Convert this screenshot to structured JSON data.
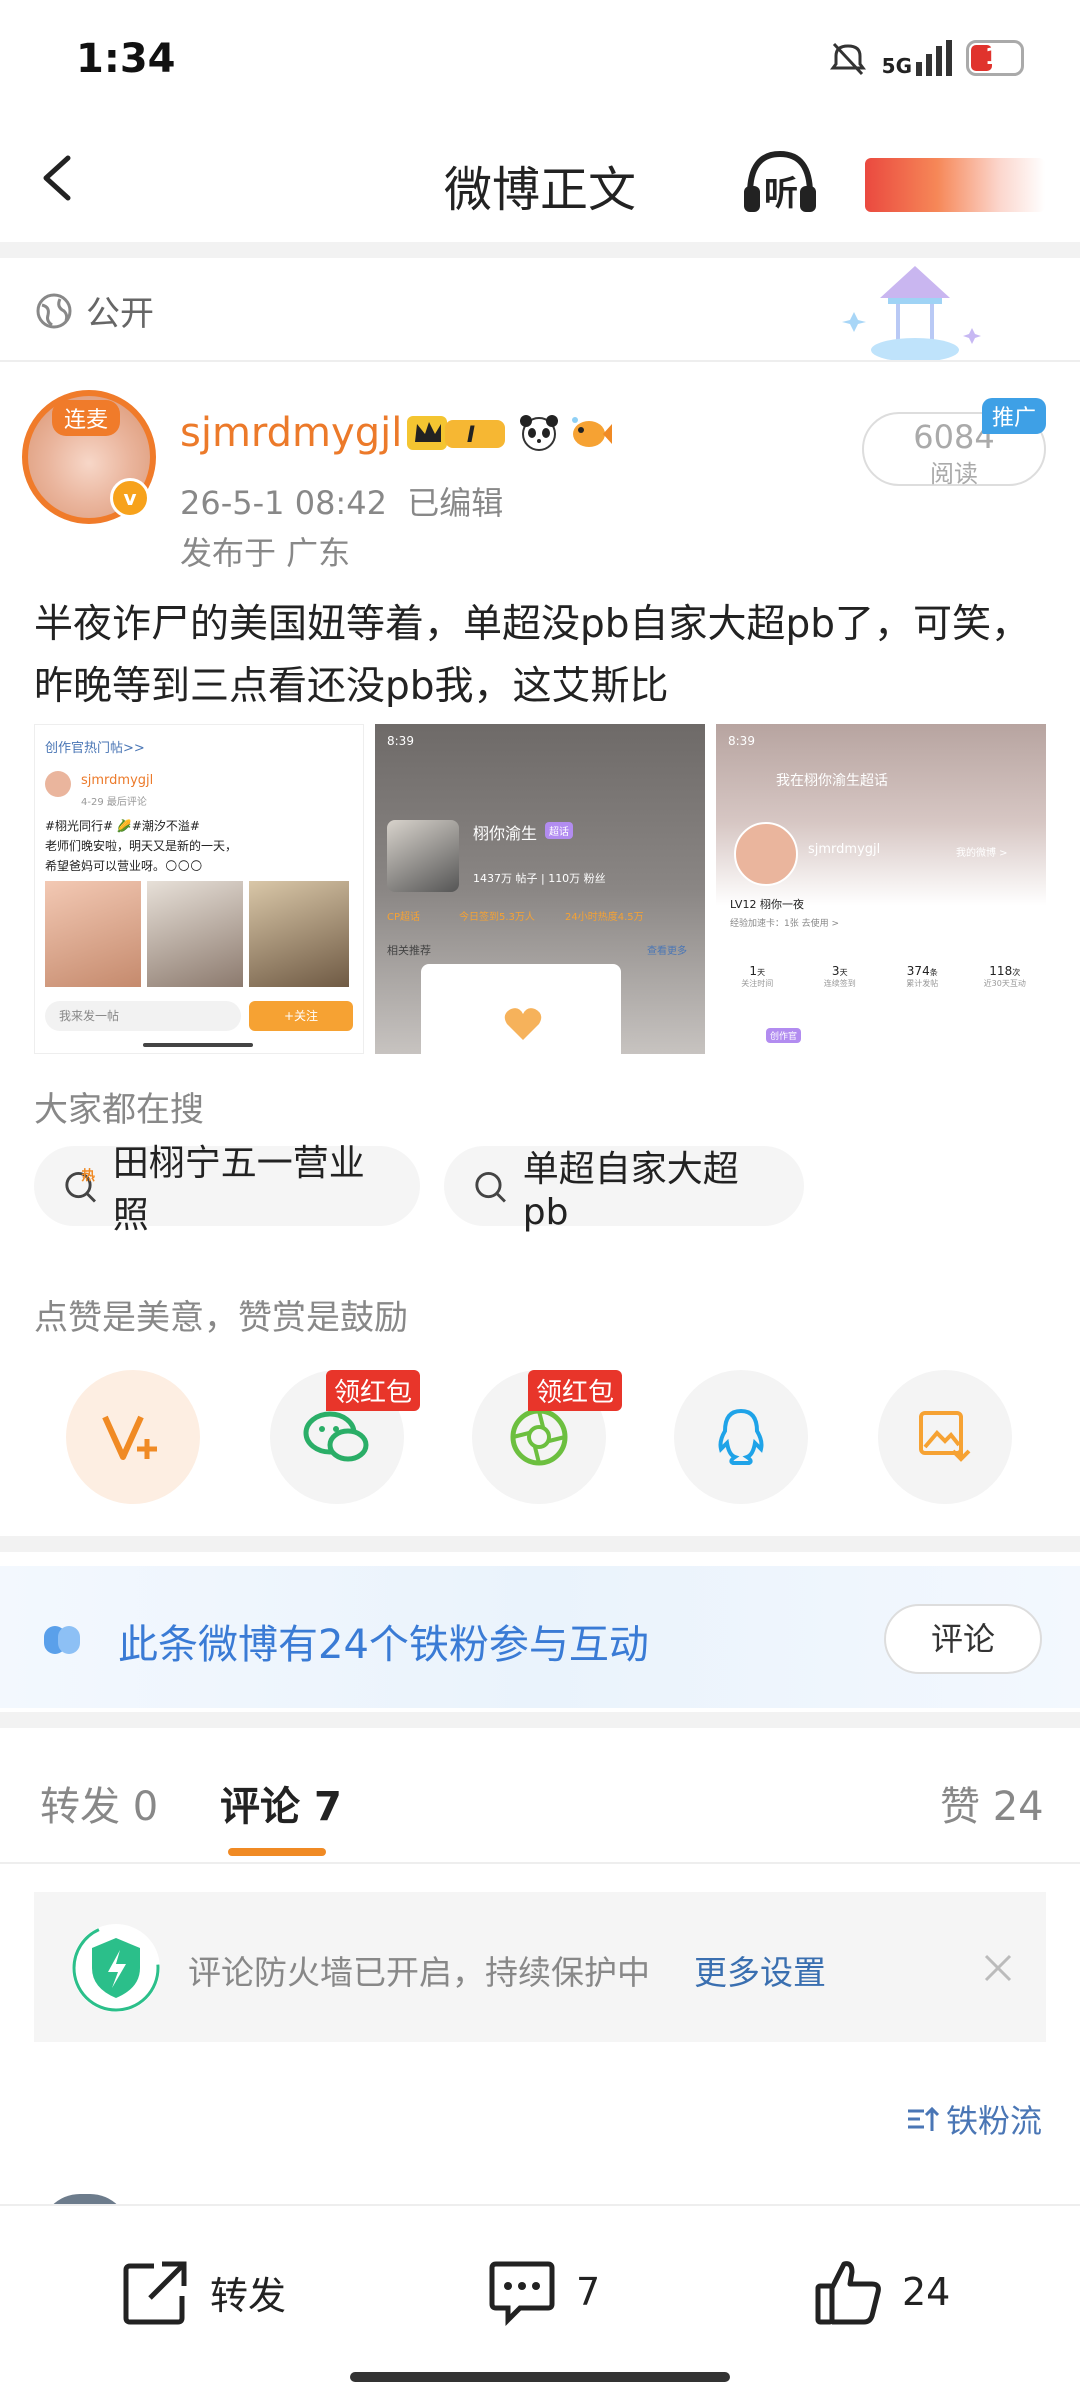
{
  "status_bar": {
    "time": "1:34",
    "network": "5G",
    "battery": "16"
  },
  "header": {
    "title": "微博正文",
    "listen_label": "听"
  },
  "post": {
    "visibility": "公开",
    "avatar_tag": "连麦",
    "author": "sjmrdmygjl",
    "time": "26-5-1 08:42",
    "edited": "已编辑",
    "location": "发布于 广东",
    "read_count": "6084",
    "read_label": "阅读",
    "promo_tag": "推广",
    "text": "半夜诈尸的美国妞等着，单超没pb自家大超pb了，可笑，昨晚等到三点看还没pb我，这艾斯比",
    "images": [
      {
        "header": "创作官热门帖>>",
        "user": "sjmrdmygjl",
        "meta": "4-29 最后评论",
        "line1": "#栩光同行# 🌽#潮汐不溢#",
        "line2": "老师们晚安啦，明天又是新的一天，",
        "line3": "希望爸妈可以营业呀。🌕🌕🌕",
        "input_placeholder": "我来发一帖",
        "follow_label": "+关注"
      },
      {
        "time": "8:39",
        "name": "栩你渝生",
        "badge": "超话",
        "stats": "1437万 帖子 | 110万 粉丝",
        "chip1": "CP超话",
        "chip2": "今日签到5.3万人",
        "chip3": "24小时热度4.5万",
        "related": "相关推荐",
        "more": "查看更多"
      },
      {
        "time": "8:39",
        "title": "我在栩你渝生超话",
        "user": "sjmrdmygjl",
        "my_weibo": "我的微博 >",
        "level": "LV12 栩你一夜",
        "level_sub": "经验加速卡：1张 去使用 >",
        "stat_values": [
          "1",
          "3",
          "374",
          "118"
        ],
        "stat_units": [
          "天",
          "天",
          "条",
          "次"
        ],
        "stat_labels": [
          "关注时间",
          "连续签到",
          "累计发帖",
          "近30天互动"
        ],
        "tag": "创作官"
      }
    ]
  },
  "trends": {
    "label": "大家都在搜",
    "items": [
      {
        "text": "田栩宁五一营业照",
        "hot_label": "热"
      },
      {
        "text": "单超自家大超pb"
      }
    ]
  },
  "reward": {
    "label": "点赞是美意，赞赏是鼓励",
    "red_packet_label": "领红包",
    "items": [
      "v-reward-icon",
      "wechat-icon",
      "moments-icon",
      "qq-icon",
      "save-image-icon"
    ]
  },
  "fans_banner": {
    "text": "此条微博有24个铁粉参与互动",
    "button": "评论"
  },
  "tabs": {
    "repost_label": "转发",
    "repost_count": "0",
    "comment_label": "评论",
    "comment_count": "7",
    "like_label": "赞",
    "like_count": "24"
  },
  "firewall": {
    "text": "评论防火墙已开启，持续保护中",
    "link": "更多设置"
  },
  "sort": {
    "label": "铁粉流"
  },
  "bottom_bar": {
    "repost": "转发",
    "comment_count": "7",
    "like_count": "24"
  },
  "colors": {
    "accent": "#F08A24",
    "link": "#3A7BD5",
    "red": "#E8352A"
  }
}
